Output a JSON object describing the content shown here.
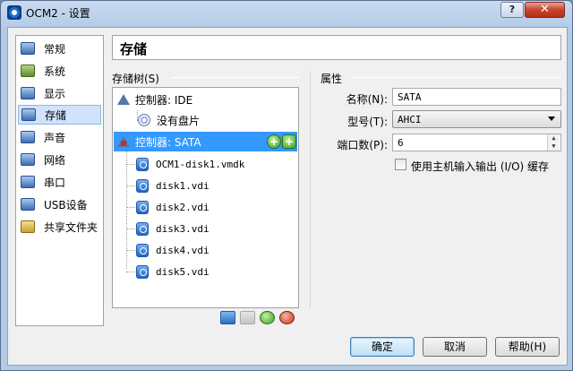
{
  "window": {
    "title": "OCM2 - 设置",
    "help_label": "?",
    "close_label": "✕"
  },
  "sidebar": {
    "items": [
      {
        "label": "常规",
        "icon": "general-icon"
      },
      {
        "label": "系统",
        "icon": "system-icon"
      },
      {
        "label": "显示",
        "icon": "display-icon"
      },
      {
        "label": "存储",
        "icon": "storage-icon",
        "selected": true
      },
      {
        "label": "声音",
        "icon": "audio-icon"
      },
      {
        "label": "网络",
        "icon": "network-icon"
      },
      {
        "label": "串口",
        "icon": "serial-port-icon"
      },
      {
        "label": "USB设备",
        "icon": "usb-icon"
      },
      {
        "label": "共享文件夹",
        "icon": "shared-folder-icon"
      }
    ]
  },
  "page_title": "存储",
  "storage_tree": {
    "group_label": "存储树(S)",
    "controllers": [
      {
        "label": "控制器: IDE",
        "items": [
          {
            "label": "没有盘片",
            "type": "cd"
          }
        ]
      },
      {
        "label": "控制器: SATA",
        "selected": true,
        "items": [
          {
            "label": "OCM1-disk1.vmdk",
            "type": "hd"
          },
          {
            "label": "disk1.vdi",
            "type": "hd"
          },
          {
            "label": "disk2.vdi",
            "type": "hd"
          },
          {
            "label": "disk3.vdi",
            "type": "hd"
          },
          {
            "label": "disk4.vdi",
            "type": "hd"
          },
          {
            "label": "disk5.vdi",
            "type": "hd"
          }
        ]
      }
    ]
  },
  "attributes": {
    "group_label": "属性",
    "name_label": "名称(N):",
    "name_value": "SATA",
    "type_label": "型号(T):",
    "type_value": "AHCI",
    "ports_label": "端口数(P):",
    "ports_value": "6",
    "host_io_cache_label": "使用主机输入输出 (I/O) 缓存",
    "host_io_cache_checked": false
  },
  "buttons": {
    "ok": "确定",
    "cancel": "取消",
    "help": "帮助(H)"
  },
  "colors": {
    "selection": "#3399ff",
    "sidebar_selection": "#cfe3fb"
  }
}
